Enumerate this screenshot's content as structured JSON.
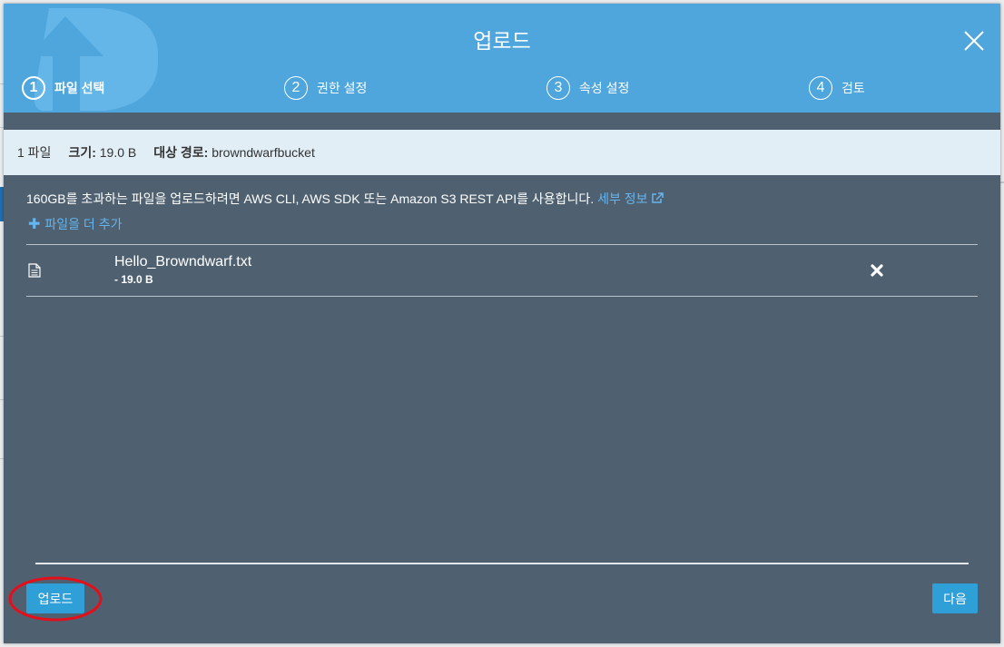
{
  "dialog": {
    "title": "업로드"
  },
  "steps": [
    {
      "number": "1",
      "label": "파일 선택",
      "active": true
    },
    {
      "number": "2",
      "label": "권한 설정",
      "active": false
    },
    {
      "number": "3",
      "label": "속성 설정",
      "active": false
    },
    {
      "number": "4",
      "label": "검토",
      "active": false
    }
  ],
  "summary": {
    "file_count": "1 파일",
    "size_label": "크기:",
    "size_value": "19.0 B",
    "target_label": "대상 경로:",
    "target_value": "browndwarfbucket"
  },
  "note": {
    "text": "160GB를 초과하는 파일을 업로드하려면 AWS CLI, AWS SDK 또는 Amazon S3 REST API를 사용합니다.",
    "link": "세부 정보"
  },
  "add_more_label": "파일을 더 추가",
  "files": [
    {
      "name": "Hello_Browndwarf.txt",
      "size": "- 19.0 B"
    }
  ],
  "buttons": {
    "upload": "업로드",
    "next": "다음"
  },
  "icons": {
    "close": "close-icon",
    "file": "file-icon",
    "remove": "remove-icon",
    "plus": "plus-icon",
    "external": "external-link-icon"
  },
  "colors": {
    "header": "#4ea6dc",
    "body": "#4f6170",
    "summary_bg": "#e1eef6",
    "button": "#2f9fd8",
    "link": "#64b5f0",
    "highlight": "#e3101b"
  }
}
